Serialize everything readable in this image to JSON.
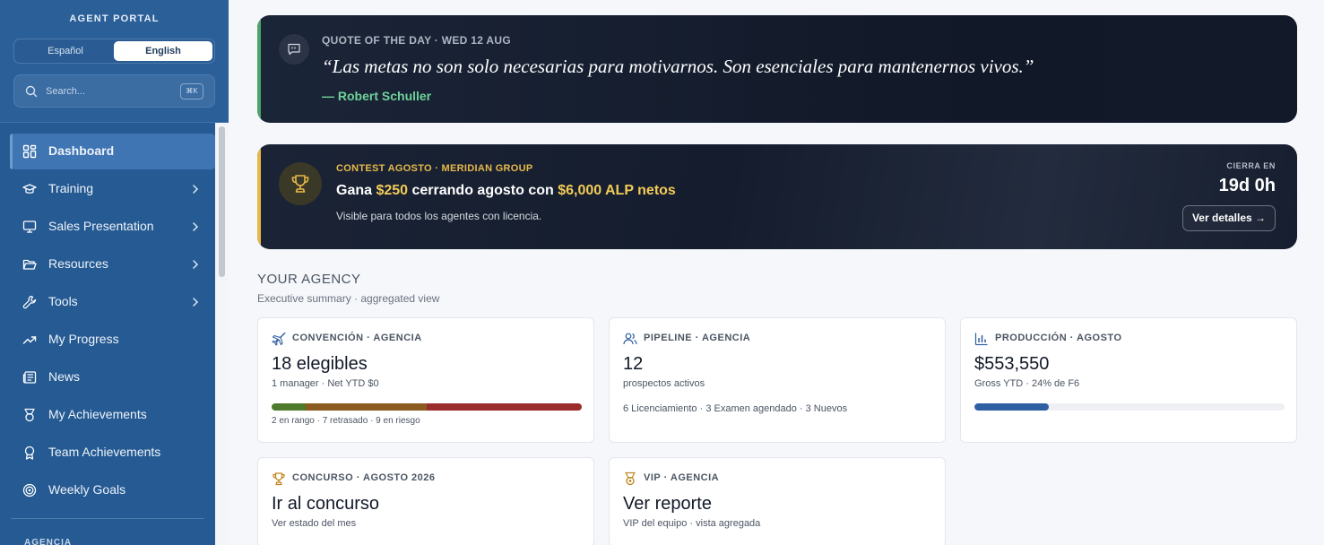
{
  "sidebar": {
    "title": "AGENT PORTAL",
    "lang": {
      "es": "Español",
      "en": "English"
    },
    "search": {
      "placeholder": "Search...",
      "shortcut": "⌘K"
    },
    "items": [
      {
        "label": "Dashboard",
        "icon": "grid-icon",
        "active": true
      },
      {
        "label": "Training",
        "icon": "graduation-cap-icon",
        "chevron": true
      },
      {
        "label": "Sales Presentation",
        "icon": "presentation-icon",
        "chevron": true
      },
      {
        "label": "Resources",
        "icon": "folder-open-icon",
        "chevron": true
      },
      {
        "label": "Tools",
        "icon": "wrench-icon",
        "chevron": true
      },
      {
        "label": "My Progress",
        "icon": "trending-up-icon"
      },
      {
        "label": "News",
        "icon": "newspaper-icon"
      },
      {
        "label": "My Achievements",
        "icon": "medal-icon"
      },
      {
        "label": "Team Achievements",
        "icon": "award-icon"
      },
      {
        "label": "Weekly Goals",
        "icon": "target-icon"
      }
    ],
    "section_label": "AGENCIA"
  },
  "quote": {
    "label": "QUOTE OF THE DAY · WED 12 AUG",
    "text": "“Las metas no son solo necesarias para motivarnos. Son esenciales para mantenernos vivos.”",
    "author": "— Robert Schuller",
    "accent_color": "#4ea36a"
  },
  "contest": {
    "label": "CONTEST AGOSTO · MERIDIAN GROUP",
    "title_pre": "Gana ",
    "title_amount": "$250",
    "title_mid": " cerrando agosto con ",
    "title_target": "$6,000 ALP netos",
    "subtitle": "Visible para todos los agentes con licencia.",
    "closes_label": "CIERRA EN",
    "closes_value": "19d 0h",
    "button": "Ver detalles →",
    "accent_color": "#e7b84a"
  },
  "agency": {
    "title": "YOUR AGENCY",
    "subtitle": "Executive summary · aggregated view",
    "cards": {
      "convention": {
        "label": "CONVENCIÓN · AGENCIA",
        "value": "18 elegibles",
        "sub": "1 manager · Net YTD $0",
        "footer": "2 en rango · 7 retrasado · 9 en riesgo",
        "segments": [
          {
            "count": 2,
            "color": "#4f7a2c"
          },
          {
            "count": 7,
            "color": "#8a5a1e"
          },
          {
            "count": 9,
            "color": "#9b2c2c"
          }
        ]
      },
      "pipeline": {
        "label": "PIPELINE · AGENCIA",
        "value": "12",
        "sub": "prospectos activos",
        "detail": "6 Licenciamiento · 3 Examen agendado · 3 Nuevos"
      },
      "production": {
        "label": "PRODUCCIÓN · AGOSTO",
        "value": "$553,550",
        "sub": "Gross YTD · 24% de F6",
        "progress": 0.24
      },
      "contest": {
        "label": "CONCURSO · AGOSTO 2026",
        "value": "Ir al concurso",
        "sub": "Ver estado del mes"
      },
      "vip": {
        "label": "VIP · AGENCIA",
        "value": "Ver reporte",
        "sub": "VIP del equipo · vista agregada"
      }
    }
  }
}
